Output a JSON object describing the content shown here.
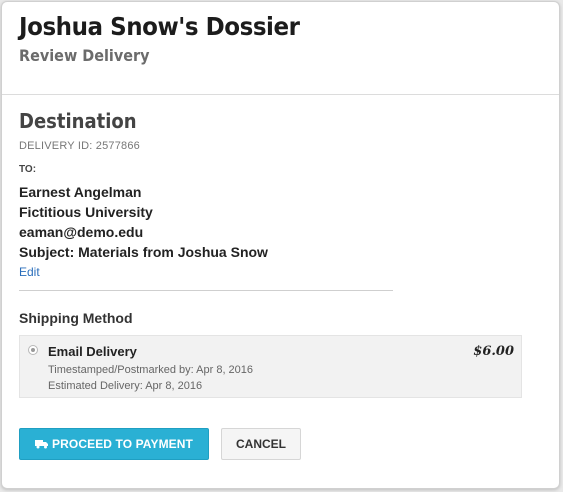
{
  "header": {
    "title": "Joshua Snow's Dossier",
    "subtitle": "Review Delivery"
  },
  "destination": {
    "heading": "Destination",
    "delivery_id": "DELIVERY ID: 2577866",
    "to_label": "TO:",
    "recipient_name": "Earnest Angelman",
    "organization": "Fictitious University",
    "email": "eaman@demo.edu",
    "subject": "Subject: Materials from Joshua Snow",
    "edit_label": "Edit"
  },
  "shipping": {
    "heading": "Shipping Method",
    "option": {
      "name": "Email Delivery",
      "timestamped": "Timestamped/Postmarked by: Apr 8, 2016",
      "estimated": "Estimated Delivery: Apr 8, 2016",
      "price": "$6.00",
      "selected": true
    }
  },
  "actions": {
    "proceed_label": "PROCEED TO PAYMENT",
    "proceed_icon": "truck-icon",
    "cancel_label": "CANCEL"
  },
  "colors": {
    "primary_button": "#2ab0d4",
    "link": "#2a6ebb"
  }
}
